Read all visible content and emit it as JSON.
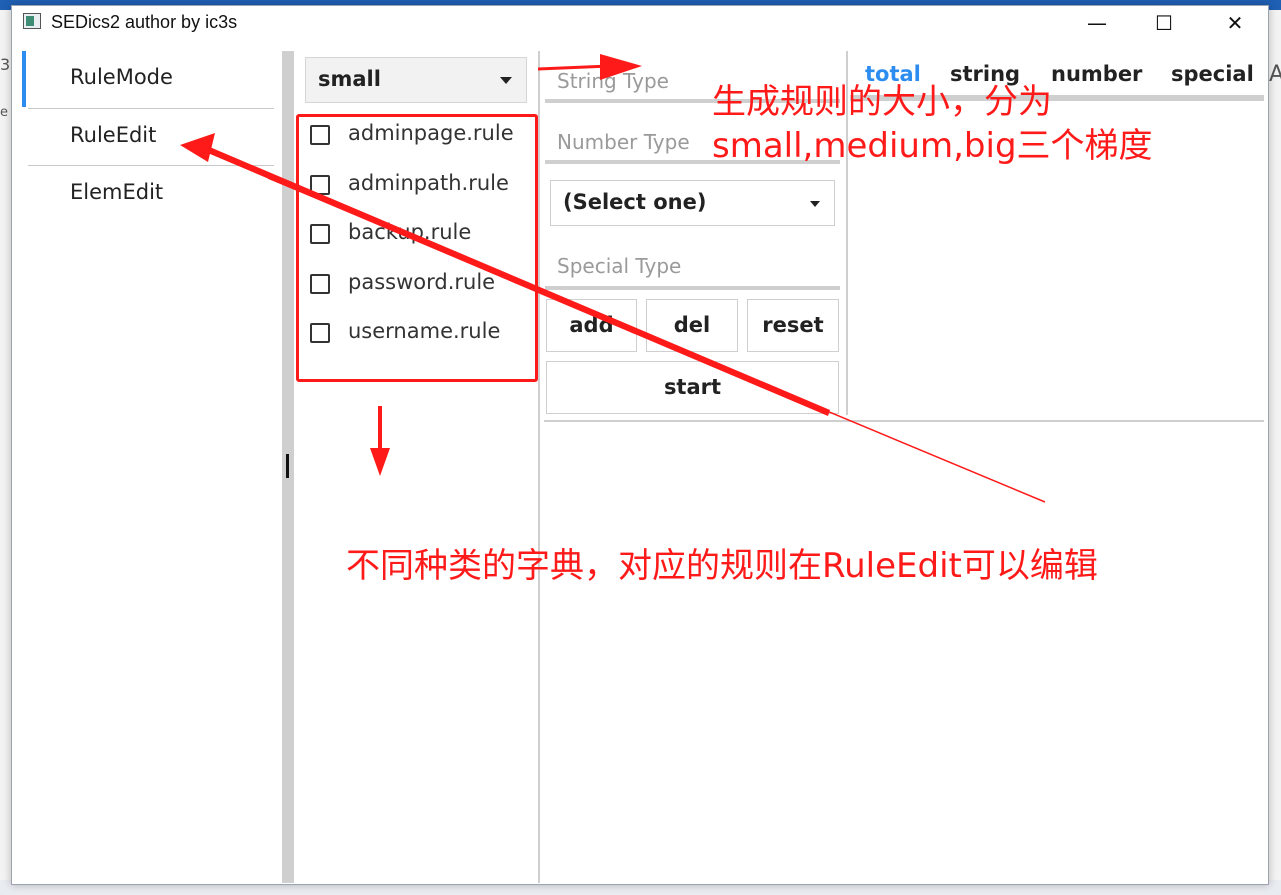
{
  "window": {
    "title": "SEDics2 author by ic3s",
    "minimize_glyph": "—",
    "maximize_glyph": "☐",
    "close_glyph": "✕"
  },
  "desktop": {
    "left_chars": [
      "3",
      "e"
    ],
    "right_chars": [
      "A"
    ]
  },
  "sidebar": {
    "items": [
      {
        "label": "RuleMode",
        "selected": true
      },
      {
        "label": "RuleEdit",
        "selected": false
      },
      {
        "label": "ElemEdit",
        "selected": false
      }
    ],
    "accent_color": "#2d8cf0"
  },
  "size_select": {
    "value": "small"
  },
  "rule_files": [
    {
      "label": "adminpage.rule",
      "checked": false
    },
    {
      "label": "adminpath.rule",
      "checked": false
    },
    {
      "label": "backup.rule",
      "checked": false
    },
    {
      "label": "password.rule",
      "checked": false
    },
    {
      "label": "username.rule",
      "checked": false
    }
  ],
  "inputs": {
    "string_type_placeholder": "String Type",
    "number_type_placeholder": "Number Type",
    "special_type_placeholder": "Special Type"
  },
  "number_select": {
    "value": "(Select one)"
  },
  "buttons": {
    "add": "add",
    "del": "del",
    "reset": "reset",
    "start": "start"
  },
  "tabs": [
    {
      "label": "total",
      "active": true
    },
    {
      "label": "string",
      "active": false
    },
    {
      "label": "number",
      "active": false
    },
    {
      "label": "special",
      "active": false
    }
  ],
  "annotations": {
    "size_note_line1": "生成规则的大小，分为",
    "size_note_line2": "small,medium,big三个梯度",
    "dict_note": "不同种类的字典，对应的规则在RuleEdit可以编辑",
    "color": "#ff1a1a"
  }
}
